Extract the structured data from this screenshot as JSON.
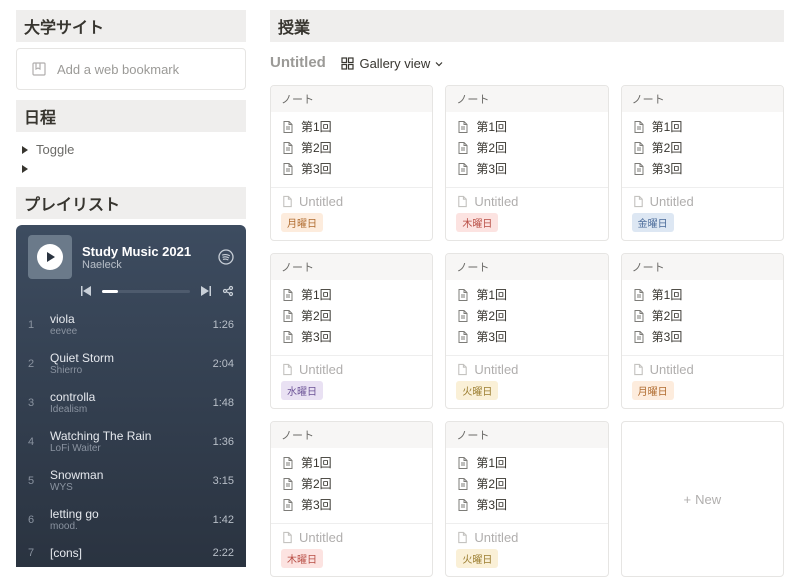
{
  "left": {
    "university_heading": "大学サイト",
    "bookmark_placeholder": "Add a web bookmark",
    "schedule_heading": "日程",
    "toggle_label": "Toggle",
    "playlist_heading": "プレイリスト"
  },
  "player": {
    "title": "Study Music 2021",
    "artist": "Naeleck",
    "tracks": [
      {
        "n": "1",
        "title": "viola",
        "artist": "eevee",
        "dur": "1:26"
      },
      {
        "n": "2",
        "title": "Quiet Storm",
        "artist": "Shierro",
        "dur": "2:04"
      },
      {
        "n": "3",
        "title": "controlla",
        "artist": "Idealism",
        "dur": "1:48"
      },
      {
        "n": "4",
        "title": "Watching The Rain",
        "artist": "LoFi Waiter",
        "dur": "1:36"
      },
      {
        "n": "5",
        "title": "Snowman",
        "artist": "WYS",
        "dur": "3:15"
      },
      {
        "n": "6",
        "title": "letting go",
        "artist": "mood.",
        "dur": "1:42"
      },
      {
        "n": "7",
        "title": "[cons]",
        "artist": "",
        "dur": "2:22"
      }
    ]
  },
  "right": {
    "heading": "授業",
    "db_title": "Untitled",
    "view_label": "Gallery view",
    "card_header": "ノート",
    "note1": "第1回",
    "note2": "第2回",
    "note3": "第3回",
    "untitled": "Untitled",
    "new_label": "New",
    "cards": [
      {
        "day": "月曜日",
        "tag": "tag-orange"
      },
      {
        "day": "木曜日",
        "tag": "tag-red"
      },
      {
        "day": "金曜日",
        "tag": "tag-blue"
      },
      {
        "day": "水曜日",
        "tag": "tag-purple"
      },
      {
        "day": "火曜日",
        "tag": "tag-yellow"
      },
      {
        "day": "月曜日",
        "tag": "tag-orange"
      },
      {
        "day": "木曜日",
        "tag": "tag-red"
      },
      {
        "day": "火曜日",
        "tag": "tag-yellow"
      }
    ]
  }
}
